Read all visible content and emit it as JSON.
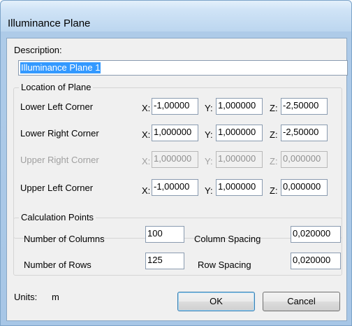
{
  "window": {
    "title": "Illuminance Plane"
  },
  "description": {
    "label": "Description:",
    "value": "Illuminance Plane 1"
  },
  "location": {
    "title": "Location of Plane",
    "axis_x": "X:",
    "axis_y": "Y:",
    "axis_z": "Z:",
    "rows": [
      {
        "label": "Lower Left Corner",
        "x": "-1,00000",
        "y": "1,000000",
        "z": "-2,50000",
        "enabled": true
      },
      {
        "label": "Lower Right Corner",
        "x": "1,000000",
        "y": "1,000000",
        "z": "-2,50000",
        "enabled": true
      },
      {
        "label": "Upper Right Corner",
        "x": "1,000000",
        "y": "1,000000",
        "z": "0,000000",
        "enabled": false
      },
      {
        "label": "Upper Left Corner",
        "x": "-1,00000",
        "y": "1,000000",
        "z": "0,000000",
        "enabled": true
      }
    ]
  },
  "calculation": {
    "title": "Calculation Points",
    "columns_label": "Number of Columns",
    "columns_value": "100",
    "rows_label": "Number of Rows",
    "rows_value": "125",
    "col_spacing_label": "Column Spacing",
    "col_spacing_value": "0,020000",
    "row_spacing_label": "Row Spacing",
    "row_spacing_value": "0,020000"
  },
  "units": {
    "label": "Units:",
    "value": "m"
  },
  "buttons": {
    "ok": "OK",
    "cancel": "Cancel"
  }
}
